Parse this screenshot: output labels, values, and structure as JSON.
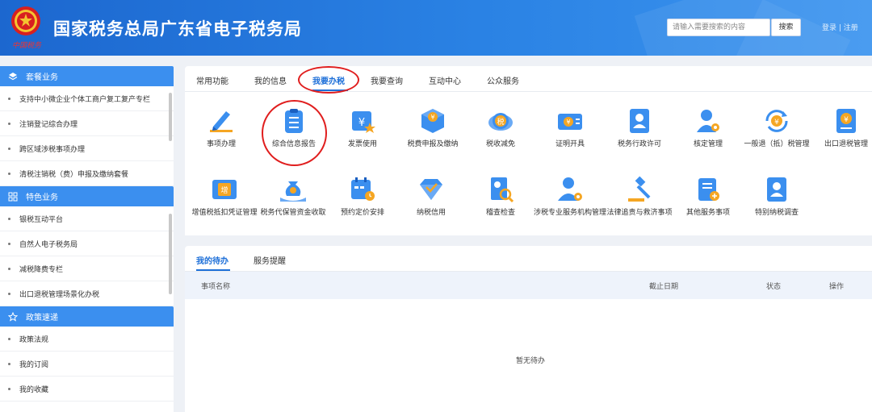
{
  "header": {
    "title": "国家税务总局广东省电子税务局",
    "emblem_text": "中国税务",
    "search_placeholder": "请输入需要搜索的内容",
    "search_button": "搜索",
    "extra_text": "登录 | 注册"
  },
  "sidebar": {
    "sections": [
      {
        "title": "套餐业务",
        "icon": "layers-icon",
        "items": [
          "支持中小微企业个体工商户复工复产专栏",
          "注销登记综合办理",
          "跨区域涉税事项办理",
          "清税注销税（费）申报及缴纳套餐"
        ]
      },
      {
        "title": "特色业务",
        "icon": "grid-icon",
        "items": [
          "银税互动平台",
          "自然人电子税务局",
          "减税降费专栏",
          "出口退税管理场景化办税"
        ]
      },
      {
        "title": "政策速递",
        "icon": "star-icon",
        "items": [
          "政策法规",
          "我的订阅",
          "我的收藏"
        ]
      }
    ]
  },
  "main": {
    "tabs": [
      "常用功能",
      "我的信息",
      "我要办税",
      "我要查询",
      "互动中心",
      "公众服务"
    ],
    "active_tab": "我要办税",
    "functions": [
      {
        "label": "事项办理",
        "icon": "pen-icon"
      },
      {
        "label": "综合信息报告",
        "icon": "clipboard-icon"
      },
      {
        "label": "发票使用",
        "icon": "invoice-icon"
      },
      {
        "label": "税费申报及缴纳",
        "icon": "yuan-box-icon"
      },
      {
        "label": "税收减免",
        "icon": "tax-relief-icon"
      },
      {
        "label": "证明开具",
        "icon": "certificate-icon"
      },
      {
        "label": "税务行政许可",
        "icon": "license-icon"
      },
      {
        "label": "核定管理",
        "icon": "user-gear-icon"
      },
      {
        "label": "一般退（抵）税管理",
        "icon": "refund-icon"
      },
      {
        "label": "出口退税管理",
        "icon": "export-refund-icon"
      },
      {
        "label": "增值税抵扣凭证管理",
        "icon": "vat-voucher-icon"
      },
      {
        "label": "税务代保管资金收取",
        "icon": "money-bag-icon"
      },
      {
        "label": "预约定价安排",
        "icon": "calendar-icon"
      },
      {
        "label": "纳税信用",
        "icon": "diamond-check-icon"
      },
      {
        "label": "稽查检查",
        "icon": "inspect-icon"
      },
      {
        "label": "涉税专业服务机构管理",
        "icon": "agency-icon"
      },
      {
        "label": "法律追责与救济事项",
        "icon": "gavel-icon"
      },
      {
        "label": "其他服务事项",
        "icon": "other-service-icon"
      },
      {
        "label": "特别纳税调查",
        "icon": "special-survey-icon"
      }
    ]
  },
  "todo": {
    "tabs": [
      "我的待办",
      "服务提醒"
    ],
    "columns": [
      "事项名称",
      "截止日期",
      "状态",
      "操作"
    ],
    "empty_text": "暂无待办"
  },
  "colors": {
    "primary": "#1d6fd8",
    "sidebar_header": "#3b8fef",
    "annotation_red": "#e01e1e"
  }
}
